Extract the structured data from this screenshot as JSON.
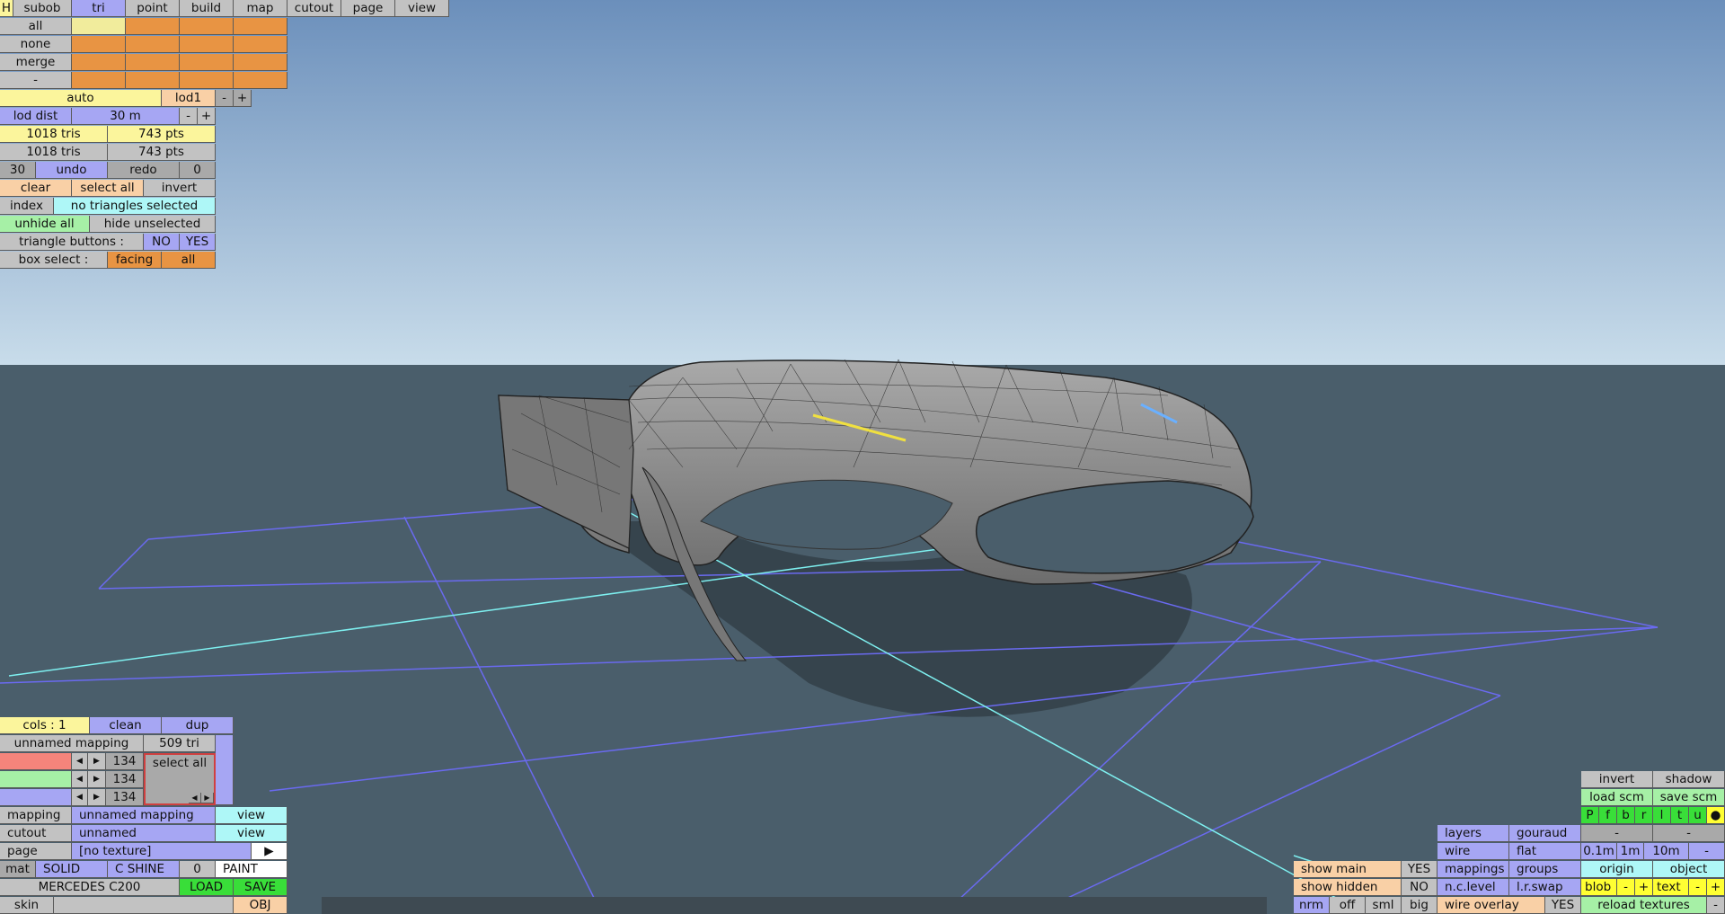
{
  "toolbar": {
    "h_label": "H",
    "tabs": [
      "subob",
      "tri",
      "point",
      "build",
      "map",
      "cutout",
      "page",
      "view"
    ],
    "active_tab": "tri"
  },
  "selection": {
    "all": "all",
    "none": "none",
    "merge": "merge",
    "minus": "-"
  },
  "lod": {
    "auto": "auto",
    "lod1": "lod1",
    "minus": "-",
    "plus": "+",
    "dist_label": "lod dist",
    "dist_value": "30 m",
    "dist_minus": "-",
    "dist_plus": "+"
  },
  "stats": {
    "tris1": "1018 tris",
    "pts1": "743 pts",
    "tris2": "1018 tris",
    "pts2": "743 pts"
  },
  "undo": {
    "count": "30",
    "undo": "undo",
    "redo": "redo",
    "redo_count": "0"
  },
  "select_row": {
    "clear": "clear",
    "select_all": "select all",
    "invert": "invert"
  },
  "index_row": {
    "index": "index",
    "status": "no triangles selected"
  },
  "hide_row": {
    "unhide_all": "unhide all",
    "hide_unselected": "hide unselected"
  },
  "tri_buttons": {
    "label": "triangle buttons :",
    "no": "NO",
    "yes": "YES"
  },
  "box_select": {
    "label": "box select :",
    "facing": "facing",
    "all": "all"
  },
  "bottom_left": {
    "cols": "cols : 1",
    "clean": "clean",
    "dup": "dup",
    "mapping_name": "unnamed mapping",
    "mapping_tris": "509 tri",
    "channel_values": [
      "134",
      "134",
      "134"
    ],
    "select_all": "select all",
    "mapping_label": "mapping",
    "mapping_value": "unnamed mapping",
    "mapping_view": "view",
    "cutout_label": "cutout",
    "cutout_value": "unnamed",
    "cutout_view": "view",
    "page_label": "page",
    "page_value": "[no texture]",
    "page_arrow": "▶",
    "mat": "mat",
    "solid": "SOLID",
    "c_shine": "C SHINE",
    "zero": "0",
    "paint": "PAINT",
    "model_name": "MERCEDES C200",
    "load": "LOAD",
    "save": "SAVE",
    "skin": "skin",
    "obj": "OBJ"
  },
  "bottom_right": {
    "invert": "invert",
    "shadow": "shadow",
    "load_scm": "load scm",
    "save_scm": "save scm",
    "letters": [
      "P",
      "f",
      "b",
      "r",
      "l",
      "t",
      "u",
      "●"
    ],
    "layers": "layers",
    "gouraud": "gouraud",
    "dash1": "-",
    "dash2": "-",
    "wire": "wire",
    "flat": "flat",
    "scale_01": "0.1m",
    "scale_1": "1m",
    "scale_10": "10m",
    "scale_minus": "-",
    "show_main": "show main",
    "show_main_val": "YES",
    "mappings": "mappings",
    "groups": "groups",
    "origin": "origin",
    "object": "object",
    "show_hidden": "show hidden",
    "show_hidden_val": "NO",
    "nc_level": "n.c.level",
    "lr_swap": "l.r.swap",
    "blob": "blob",
    "blob_minus": "-",
    "blob_plus": "+",
    "text": "text",
    "text_minus": "-",
    "text_plus": "+",
    "nrm": "nrm",
    "off": "off",
    "sml": "sml",
    "big": "big",
    "wire_overlay": "wire overlay",
    "wire_overlay_val": "YES",
    "reload_textures": "reload textures",
    "reload_minus": "-"
  },
  "colors": {
    "sky_top": "#6b8fbb",
    "sky_bottom": "#c8dcea",
    "ground": "#4a5e6b",
    "grid": "#6a6af0",
    "axis": "#7ef0f0"
  }
}
